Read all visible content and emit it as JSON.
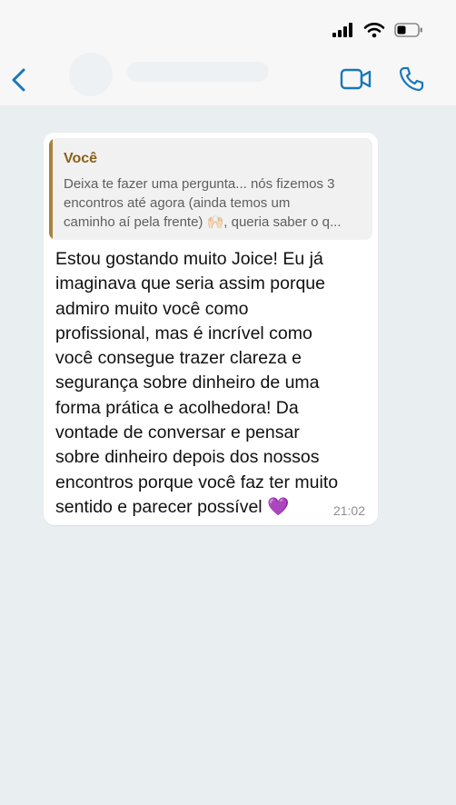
{
  "colors": {
    "accent": "#1877b9",
    "quote_author": "#8a6116",
    "quote_bar": "#a9823a",
    "chat_bg": "#e9eef1"
  },
  "icons": {
    "back": "chevron-left-icon",
    "video": "video-camera-icon",
    "phone": "phone-icon",
    "signal": "cellular-signal-icon",
    "wifi": "wifi-icon",
    "battery": "battery-icon"
  },
  "header": {
    "contact_name": "",
    "battery_level": 0.35
  },
  "message": {
    "quote_author": "Você",
    "quote_text": "Deixa te fazer uma pergunta... nós fizemos 3\nencontros até agora (ainda temos um\ncaminho aí pela frente) 🙌🏻, queria saber o q...",
    "body": "Estou gostando muito Joice! Eu já\nimaginava que seria assim porque\nadmiro muito você como\nprofissional, mas é incrível como\nvocê consegue trazer clareza e\nsegurança sobre dinheiro de uma\nforma prática e acolhedora! Da\nvontade de conversar e pensar\nsobre dinheiro depois dos nossos\nencontros porque você faz ter muito\nsentido e parecer possível 💜",
    "time": "21:02"
  }
}
